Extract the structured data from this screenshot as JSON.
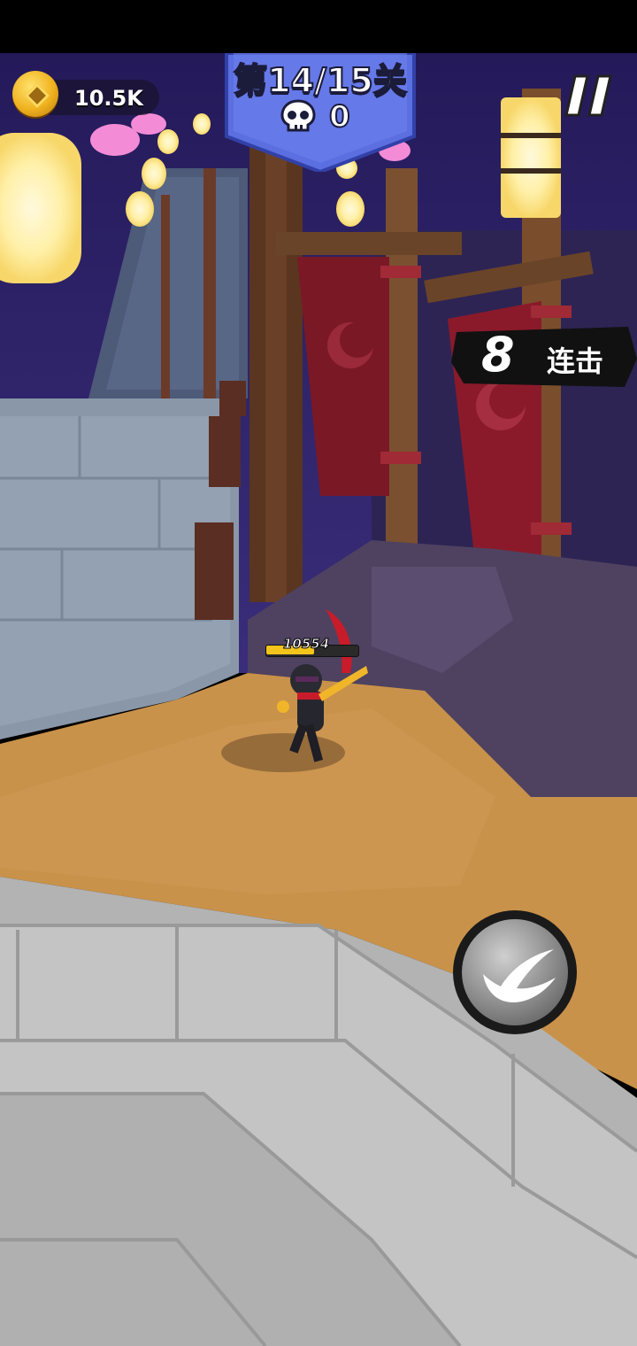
{
  "hud": {
    "coins": {
      "icon": "coin-icon",
      "amount": "10.5K"
    },
    "level": {
      "label": "第14/15关",
      "kills_icon": "skull-icon",
      "kills": "0",
      "banner_color": "#5b6fe0"
    },
    "pause": {
      "icon": "pause-icon"
    },
    "combo": {
      "count": "8",
      "label": "连击"
    },
    "player": {
      "hp_value": "10554",
      "hp_fraction": 0.53
    },
    "attack": {
      "icon": "slash-attack-icon"
    }
  },
  "colors": {
    "accent": "#f3c41b",
    "banner": "#5b6fe0",
    "sky": "#2a1f66",
    "sand": "#c9924a",
    "stone": "#b8b8b8"
  }
}
